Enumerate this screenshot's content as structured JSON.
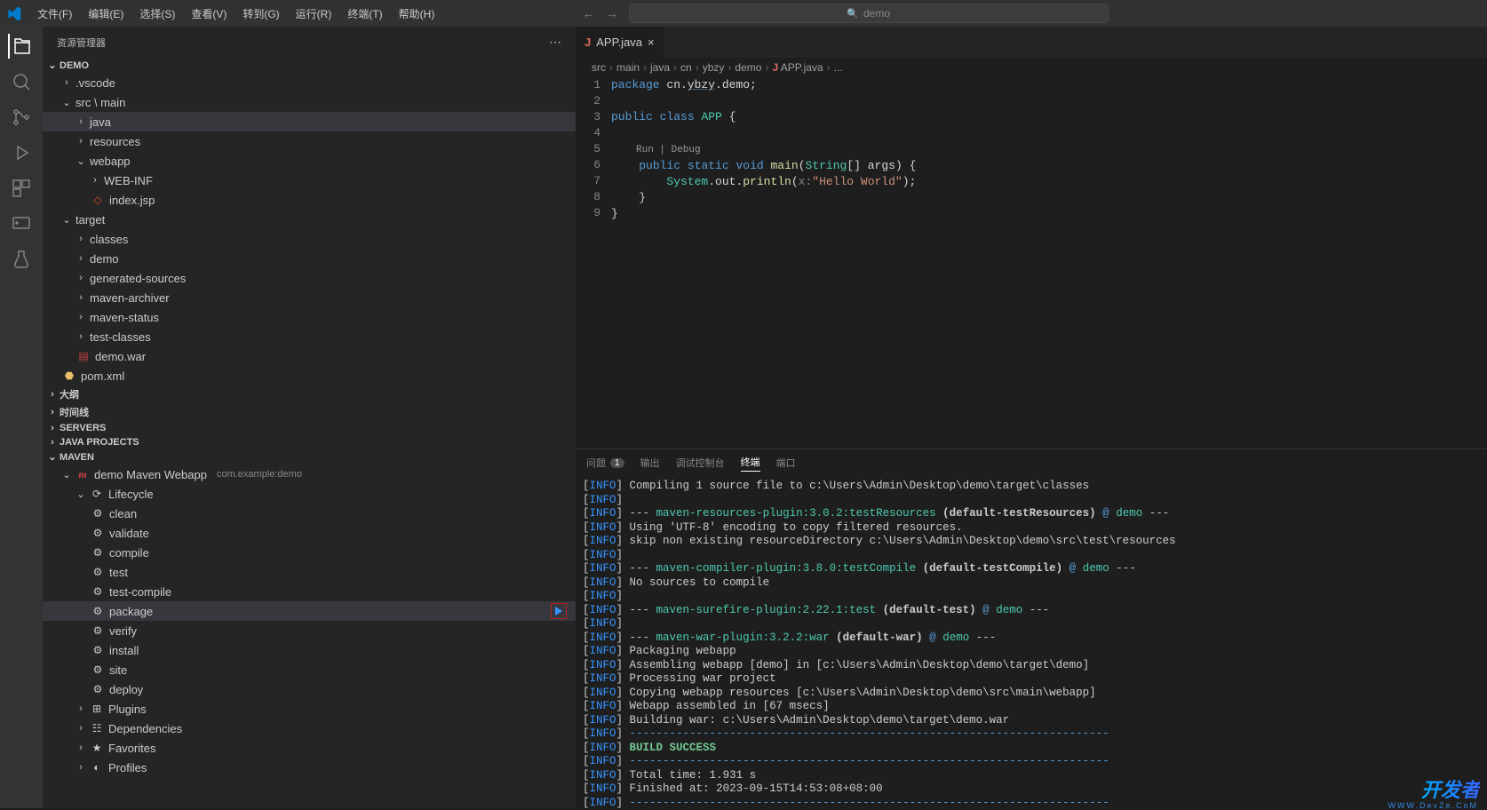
{
  "menu": {
    "file": "文件(F)",
    "edit": "编辑(E)",
    "select": "选择(S)",
    "view": "查看(V)",
    "goto": "转到(G)",
    "run": "运行(R)",
    "terminal": "终端(T)",
    "help": "帮助(H)"
  },
  "search": {
    "placeholder": "demo"
  },
  "sidebar": {
    "title": "资源管理器",
    "sections": {
      "demo": "DEMO",
      "outline": "大纲",
      "timeline": "时间线",
      "servers": "SERVERS",
      "javaprojects": "JAVA PROJECTS",
      "maven": "MAVEN"
    },
    "demoTree": {
      "vscode": ".vscode",
      "srcmain": "src \\ main",
      "java": "java",
      "resources": "resources",
      "webapp": "webapp",
      "webinf": "WEB-INF",
      "indexjsp": "index.jsp",
      "target": "target",
      "classes": "classes",
      "demo": "demo",
      "generated": "generated-sources",
      "archiver": "maven-archiver",
      "status": "maven-status",
      "testclasses": "test-classes",
      "demowar": "demo.war",
      "pom": "pom.xml"
    },
    "maven": {
      "project": "demo Maven Webapp",
      "coords": "com.example:demo",
      "lifecycle": "Lifecycle",
      "phases": [
        "clean",
        "validate",
        "compile",
        "test",
        "test-compile",
        "package",
        "verify",
        "install",
        "site",
        "deploy"
      ],
      "plugins": "Plugins",
      "deps": "Dependencies",
      "favs": "Favorites",
      "profiles": "Profiles"
    }
  },
  "editor": {
    "tab": {
      "name": "APP.java"
    },
    "breadcrumb": [
      "src",
      "main",
      "java",
      "cn",
      "ybzy",
      "demo",
      "APP.java",
      "..."
    ],
    "codelens": "Run | Debug",
    "code": {
      "lines": [
        1,
        2,
        3,
        4,
        5,
        6,
        7,
        8,
        9
      ],
      "pkg": "package",
      "cn": "cn",
      "ybzy": "ybzy",
      "demo": "demo",
      "public": "public",
      "class": "class",
      "cls": "APP",
      "static": "static",
      "void": "void",
      "main": "main",
      "String": "String",
      "args": "args",
      "System": "System",
      "out": "out",
      "println": "println",
      "x": "x:",
      "hello": "\"Hello World\""
    }
  },
  "panel": {
    "tabs": {
      "problems": "问题",
      "problemsBadge": "1",
      "output": "输出",
      "debugconsole": "调试控制台",
      "terminal": "终端",
      "ports": "端口"
    },
    "lines": [
      {
        "t": "Compiling 1 source file to c:\\Users\\Admin\\Desktop\\demo\\target\\classes"
      },
      {
        "t": ""
      },
      {
        "plugin": "maven-resources-plugin:3.0.2:testResources",
        "phase": "(default-testResources)",
        "proj": "demo",
        "dash": true
      },
      {
        "t": "Using 'UTF-8' encoding to copy filtered resources."
      },
      {
        "t": "skip non existing resourceDirectory c:\\Users\\Admin\\Desktop\\demo\\src\\test\\resources"
      },
      {
        "t": ""
      },
      {
        "plugin": "maven-compiler-plugin:3.8.0:testCompile",
        "phase": "(default-testCompile)",
        "proj": "demo",
        "dash": true
      },
      {
        "t": "No sources to compile"
      },
      {
        "t": ""
      },
      {
        "plugin": "maven-surefire-plugin:2.22.1:test",
        "phase": "(default-test)",
        "proj": "demo",
        "dash": true
      },
      {
        "t": ""
      },
      {
        "plugin": "maven-war-plugin:3.2.2:war",
        "phase": "(default-war)",
        "proj": "demo",
        "dash": true
      },
      {
        "t": "Packaging webapp"
      },
      {
        "t": "Assembling webapp [demo] in [c:\\Users\\Admin\\Desktop\\demo\\target\\demo]"
      },
      {
        "t": "Processing war project"
      },
      {
        "t": "Copying webapp resources [c:\\Users\\Admin\\Desktop\\demo\\src\\main\\webapp]"
      },
      {
        "t": "Webapp assembled in [67 msecs]"
      },
      {
        "t": "Building war: c:\\Users\\Admin\\Desktop\\demo\\target\\demo.war"
      },
      {
        "dashline": true
      },
      {
        "success": "BUILD SUCCESS"
      },
      {
        "dashline": true
      },
      {
        "t": "Total time:  1.931 s"
      },
      {
        "t": "Finished at: 2023-09-15T14:53:08+08:00"
      },
      {
        "dashline": true
      }
    ]
  },
  "watermark": {
    "title": "开发者",
    "sub": "WWW.DevZe.CoM"
  }
}
